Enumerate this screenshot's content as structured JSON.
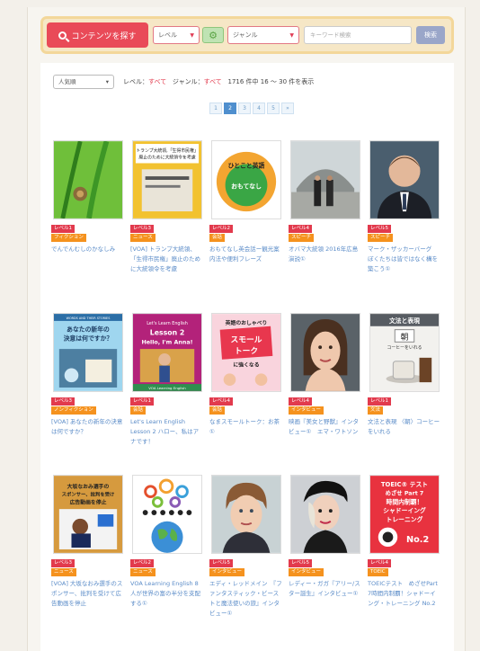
{
  "search": {
    "button_label": "コンテンツを探す",
    "level_select": "レベル",
    "genre_select": "ジャンル",
    "keyword_placeholder": "キーワード検索",
    "keyword_button": "検索"
  },
  "toolbar": {
    "sort_value": "人気順",
    "level_label": "レベル：",
    "level_value": "すべて",
    "genre_label": "ジャンル：",
    "genre_value": "すべて",
    "count_text": "1716 件中 16 ～ 30 件を表示"
  },
  "pager": [
    "1",
    "2",
    "3",
    "4",
    "5",
    "»"
  ],
  "pager_active": 1,
  "cards": [
    {
      "tags": [
        {
          "t": "レベル1",
          "c": "red"
        },
        {
          "t": "フィクション",
          "c": "orange"
        }
      ],
      "title": "でんでんむしのかなしみ"
    },
    {
      "tags": [
        {
          "t": "レベル3",
          "c": "red"
        },
        {
          "t": "ニュース",
          "c": "orange"
        }
      ],
      "title": "[VOA] トランプ大統領、「生得市民権」廃止のために大統領令を考慮",
      "thumb_text": [
        "トランプ大統領,「生得市民権」",
        "廃止のために大統領令を考慮"
      ]
    },
    {
      "tags": [
        {
          "t": "レベル2",
          "c": "red"
        },
        {
          "t": "会話",
          "c": "orange"
        }
      ],
      "title": "おもてなし英会話ー観光案内法や便利フレーズ",
      "thumb_text": [
        "ひとこと英語",
        "おもてなし"
      ]
    },
    {
      "tags": [
        {
          "t": "レベル4",
          "c": "red"
        },
        {
          "t": "スピーチ",
          "c": "orange"
        }
      ],
      "title": "オバマ大統領 2016年広島演説①"
    },
    {
      "tags": [
        {
          "t": "レベル5",
          "c": "red"
        },
        {
          "t": "スピーチ",
          "c": "orange"
        }
      ],
      "title": "マーク・ザッカーバーグ　ぼくたちは皆ではなく構を築こう①"
    },
    {
      "tags": [
        {
          "t": "レベル3",
          "c": "red"
        },
        {
          "t": "ノンフィクション",
          "c": "orange"
        }
      ],
      "title": "[VOA] あなたの新年の決意は何ですか？",
      "thumb_text": [
        "WORDS AND THEIR STORIES",
        "あなたの新年の",
        "決意は何ですか？"
      ]
    },
    {
      "tags": [
        {
          "t": "レベル1",
          "c": "red"
        },
        {
          "t": "会話",
          "c": "orange"
        }
      ],
      "title": "Let's Learn English Lesson 2 ハロー、私はアナです！",
      "thumb_text": [
        "Let's Learn English",
        "Lesson 2",
        "Hello, I'm Anna!",
        "VOA Learning English"
      ]
    },
    {
      "tags": [
        {
          "t": "レベル4",
          "c": "red"
        },
        {
          "t": "会話",
          "c": "orange"
        }
      ],
      "title": "なまスモールトーク：お茶①",
      "thumb_text": [
        "英語のおしゃべり",
        "スモール",
        "トーク",
        "に強くなる"
      ]
    },
    {
      "tags": [
        {
          "t": "レベル4",
          "c": "red"
        },
        {
          "t": "インタビュー",
          "c": "orange"
        }
      ],
      "title": "映画『美女と野獣』インタビュー①　エマ・ワトソン"
    },
    {
      "tags": [
        {
          "t": "レベル1",
          "c": "red"
        },
        {
          "t": "文法",
          "c": "orange"
        }
      ],
      "title": "文法と表現 〈朝〉コーヒーをいれる",
      "thumb_text": [
        "文法と表現",
        "朝",
        "コーヒーをいれる"
      ]
    },
    {
      "tags": [
        {
          "t": "レベル3",
          "c": "red"
        },
        {
          "t": "ニュース",
          "c": "orange"
        }
      ],
      "title": "[VOA] 大坂なおみ選手のスポンサー、批判を受けて広告動画を停止",
      "thumb_text": [
        "大坂なおみ選手の",
        "スポンサー、批判を受け",
        "広告動画を停止"
      ]
    },
    {
      "tags": [
        {
          "t": "レベル2",
          "c": "red"
        },
        {
          "t": "ニュース",
          "c": "orange"
        }
      ],
      "title": "VOA Learning English 8人が世界の富の半分を支配する①"
    },
    {
      "tags": [
        {
          "t": "レベル5",
          "c": "red"
        },
        {
          "t": "インタビュー",
          "c": "orange"
        }
      ],
      "title": "エディ・レッドメイン　『ファンタスティック・ビーストと魔法使いの旅』インタビュー①"
    },
    {
      "tags": [
        {
          "t": "レベル5",
          "c": "red"
        },
        {
          "t": "インタビュー",
          "c": "orange"
        }
      ],
      "title": "レディー・ガガ『アリー/スター誕生』インタビュー①"
    },
    {
      "tags": [
        {
          "t": "レベル4",
          "c": "red"
        },
        {
          "t": "TOEIC",
          "c": "orange"
        }
      ],
      "title": "TOEICテスト　めざせPart 7時間内制覇！シャドーイング・トレーニング No.2",
      "thumb_text": [
        "TOEIC® テスト",
        "めざせ Part 7",
        "時間内制覇！",
        "シャドーイング",
        "トレーニング",
        "No.2"
      ]
    }
  ],
  "colors": {
    "accent_red": "#e23a4d",
    "accent_orange": "#f5921e",
    "link_blue": "#5b8cc8",
    "search_bg": "#f6e7c6"
  }
}
